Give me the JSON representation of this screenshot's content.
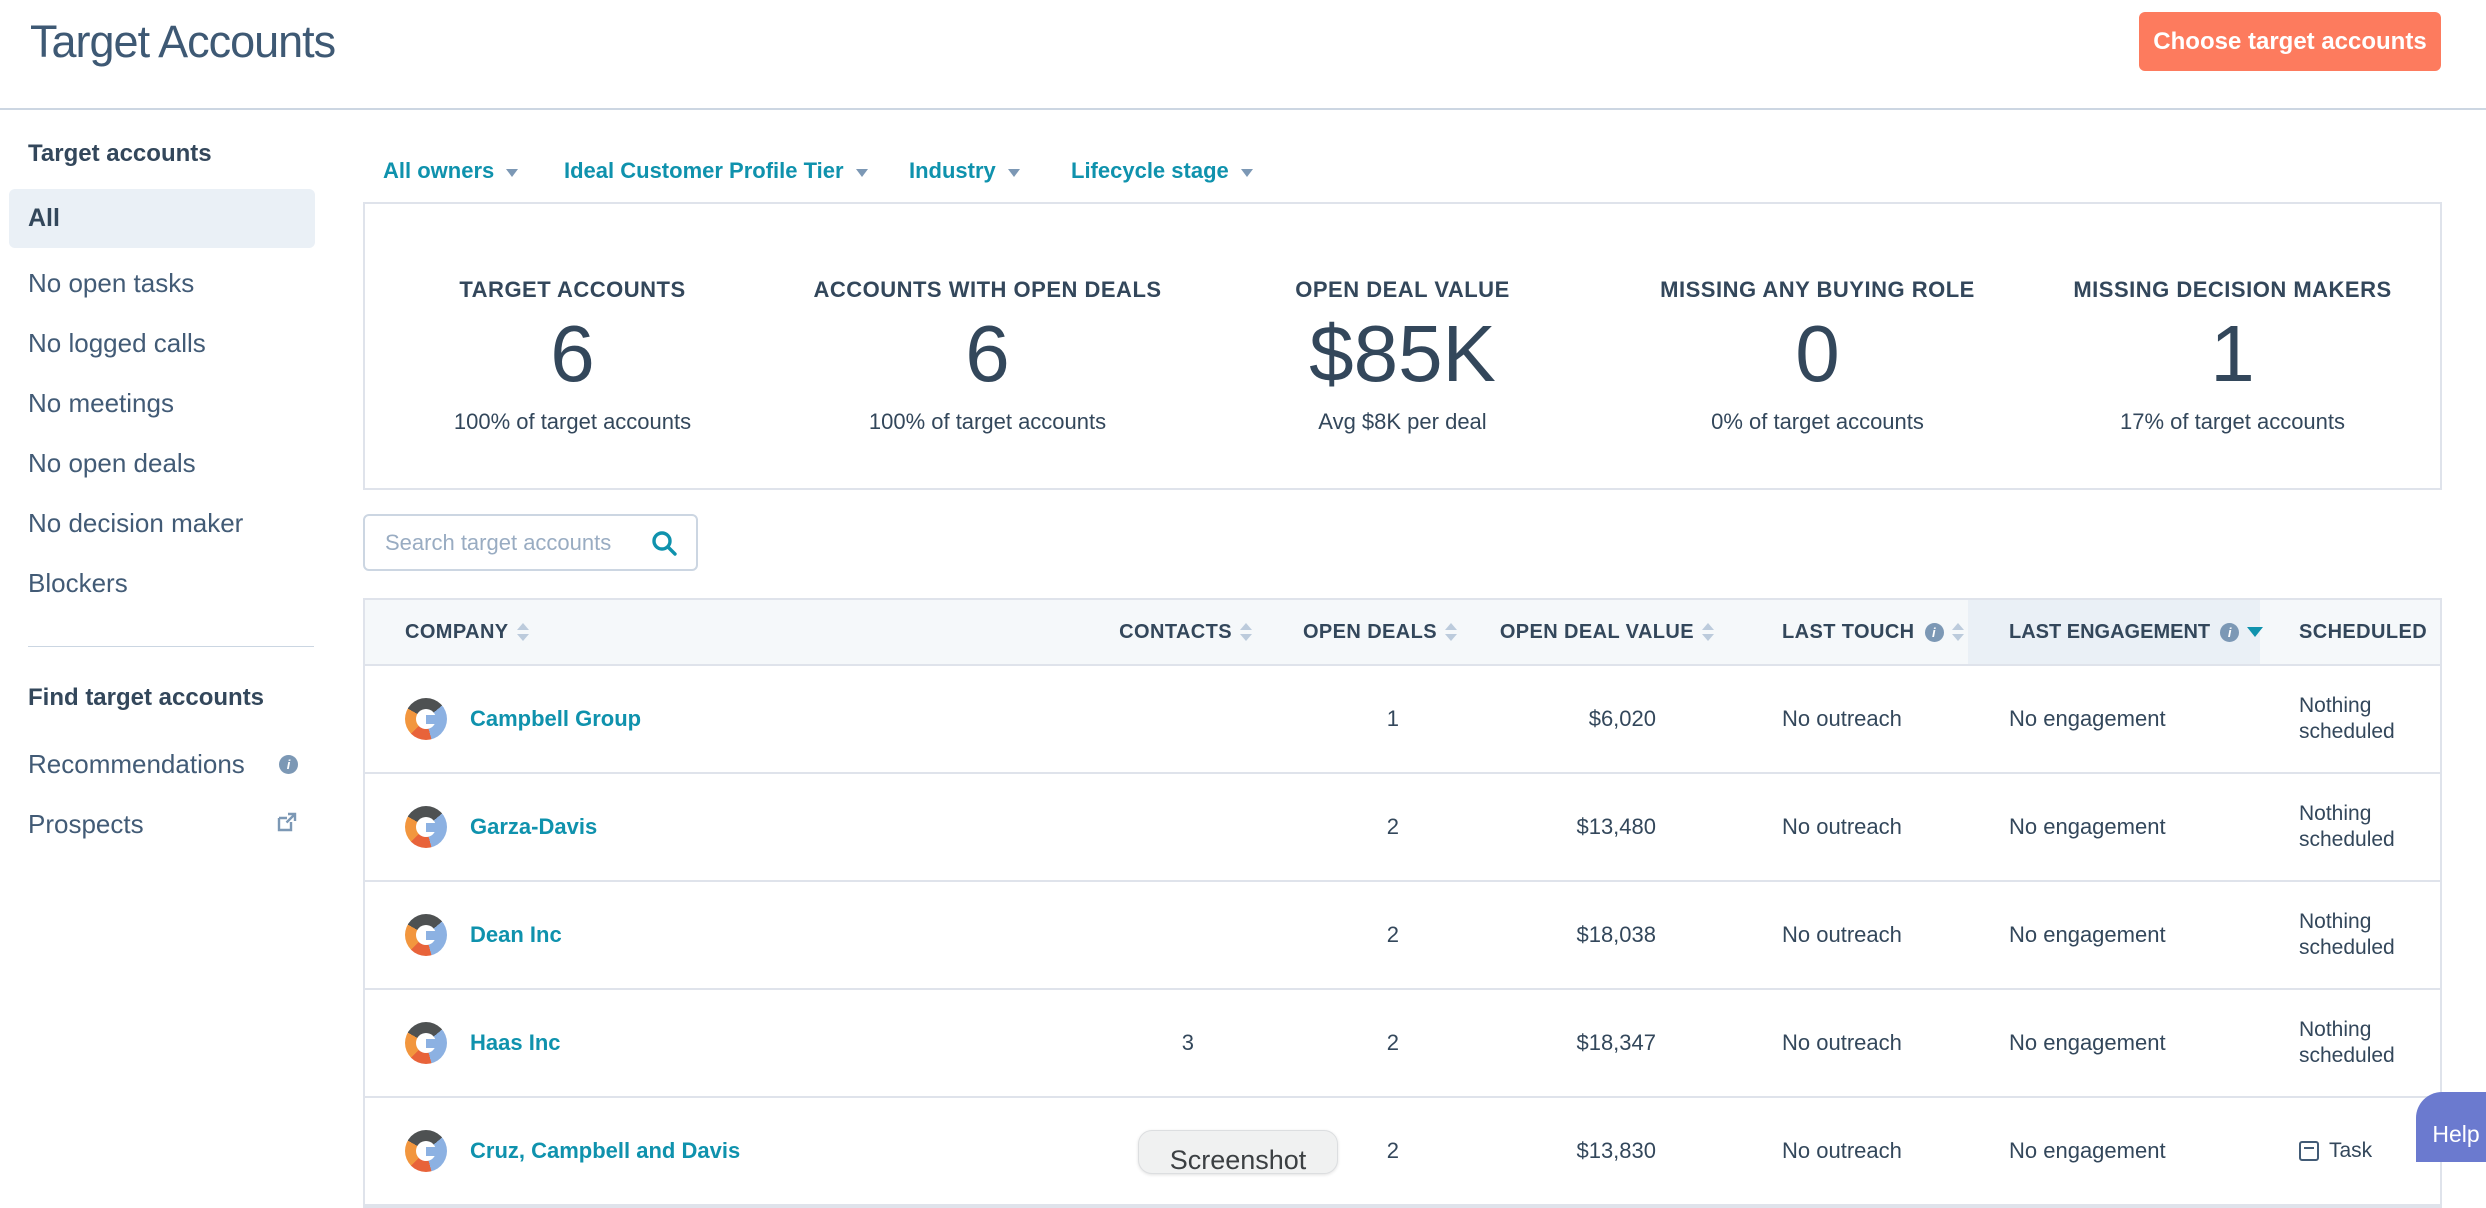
{
  "page": {
    "title": "Target Accounts"
  },
  "header": {
    "choose_button": "Choose target accounts"
  },
  "sidebar": {
    "section1_title": "Target accounts",
    "items": [
      "All",
      "No open tasks",
      "No logged calls",
      "No meetings",
      "No open deals",
      "No decision maker",
      "Blockers"
    ],
    "selected_item": "All",
    "section2_title": "Find target accounts",
    "links": [
      {
        "label": "Recommendations",
        "icon": "info"
      },
      {
        "label": "Prospects",
        "icon": "external-link"
      }
    ]
  },
  "filters": [
    {
      "label": "All owners"
    },
    {
      "label": "Ideal Customer Profile Tier"
    },
    {
      "label": "Industry"
    },
    {
      "label": "Lifecycle stage"
    }
  ],
  "stats": [
    {
      "label": "TARGET ACCOUNTS",
      "value": "6",
      "sub": "100% of target accounts"
    },
    {
      "label": "ACCOUNTS WITH OPEN DEALS",
      "value": "6",
      "sub": "100% of target accounts"
    },
    {
      "label": "OPEN DEAL VALUE",
      "value": "$85K",
      "sub": "Avg $8K per deal"
    },
    {
      "label": "MISSING ANY BUYING ROLE",
      "value": "0",
      "sub": "0% of target accounts"
    },
    {
      "label": "MISSING DECISION MAKERS",
      "value": "1",
      "sub": "17% of target accounts"
    }
  ],
  "search": {
    "placeholder": "Search target accounts"
  },
  "table": {
    "columns": [
      {
        "label": "COMPANY",
        "sort": "both",
        "info": false,
        "highlighted": false
      },
      {
        "label": "CONTACTS",
        "sort": "both",
        "info": false,
        "highlighted": false
      },
      {
        "label": "OPEN DEALS",
        "sort": "both",
        "info": false,
        "highlighted": false
      },
      {
        "label": "OPEN DEAL VALUE",
        "sort": "both",
        "info": false,
        "highlighted": false
      },
      {
        "label": "LAST TOUCH",
        "sort": "both",
        "info": true,
        "highlighted": false
      },
      {
        "label": "LAST ENGAGEMENT",
        "sort": "desc",
        "info": true,
        "highlighted": true
      },
      {
        "label": "SCHEDULED",
        "sort": "none",
        "info": false,
        "highlighted": false
      }
    ],
    "rows": [
      {
        "company": "Campbell Group",
        "contacts": "",
        "open_deals": "1",
        "open_deal_value": "$6,020",
        "last_touch": "No outreach",
        "last_engagement": "No engagement",
        "scheduled": "Nothing scheduled",
        "scheduled_type": "text"
      },
      {
        "company": "Garza-Davis",
        "contacts": "",
        "open_deals": "2",
        "open_deal_value": "$13,480",
        "last_touch": "No outreach",
        "last_engagement": "No engagement",
        "scheduled": "Nothing scheduled",
        "scheduled_type": "text"
      },
      {
        "company": "Dean Inc",
        "contacts": "",
        "open_deals": "2",
        "open_deal_value": "$18,038",
        "last_touch": "No outreach",
        "last_engagement": "No engagement",
        "scheduled": "Nothing scheduled",
        "scheduled_type": "text"
      },
      {
        "company": "Haas Inc",
        "contacts": "3",
        "open_deals": "2",
        "open_deal_value": "$18,347",
        "last_touch": "No outreach",
        "last_engagement": "No engagement",
        "scheduled": "Nothing scheduled",
        "scheduled_type": "text"
      },
      {
        "company": "Cruz, Campbell and Davis",
        "contacts": "",
        "open_deals": "2",
        "open_deal_value": "$13,830",
        "last_touch": "No outreach",
        "last_engagement": "No engagement",
        "scheduled": "Task",
        "scheduled_type": "task"
      }
    ]
  },
  "overlay": {
    "screenshot_label": "Screenshot"
  },
  "help": {
    "label": "Help"
  }
}
